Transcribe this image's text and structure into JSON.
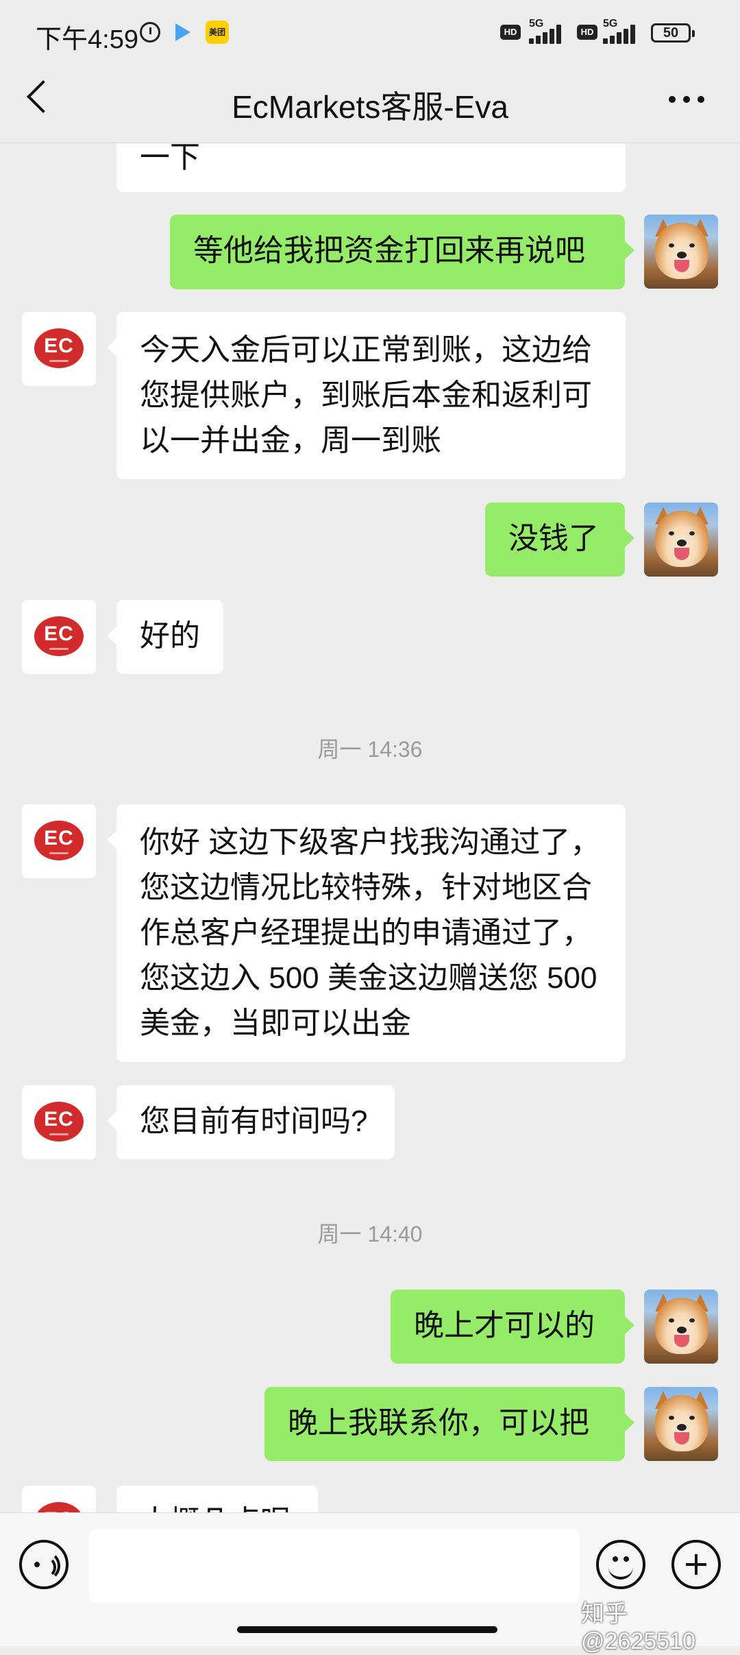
{
  "status_bar": {
    "time": "下午4:59",
    "app_badge": "美团",
    "network_1": "5G",
    "network_2": "5G",
    "hd_1": "HD",
    "hd_2": "HD",
    "battery": "50"
  },
  "header": {
    "title": "EcMarkets客服-Eva"
  },
  "messages": [
    {
      "side": "left",
      "lines": [
        "一下"
      ]
    },
    {
      "side": "right",
      "lines": [
        "等他给我把资金打回来再说吧"
      ]
    },
    {
      "side": "left",
      "avatar_logo": "EC",
      "lines": [
        "今天入金后可以正常到账，这边给",
        "您提供账户，到账后本金和返利可",
        "以一并出金，周一到账"
      ]
    },
    {
      "side": "right",
      "lines": [
        "没钱了"
      ]
    },
    {
      "side": "left",
      "avatar_logo": "EC",
      "lines": [
        "好的"
      ]
    },
    {
      "side": "left",
      "avatar_logo": "EC",
      "lines": [
        "你好 这边下级客户找我沟通过了，",
        "您这边情况比较特殊，针对地区合",
        "作总客户经理提出的申请通过了，",
        "您这边入 500 美金这边赠送您 500",
        "美金，当即可以出金"
      ]
    },
    {
      "side": "left",
      "avatar_logo": "EC",
      "lines": [
        "您目前有时间吗?"
      ]
    },
    {
      "side": "right",
      "lines": [
        "晚上才可以的"
      ]
    },
    {
      "side": "right",
      "lines": [
        "晚上我联系你，可以把"
      ]
    },
    {
      "side": "left",
      "avatar_logo": "EC",
      "lines": [
        "大概几点呢"
      ]
    }
  ],
  "timestamps": [
    "周一 14:36",
    "周一 14:40"
  ],
  "input_bar": {
    "voice_icon": "voice-icon",
    "emoji_icon": "emoji-icon",
    "plus_icon": "plus-icon",
    "watermark": "知乎 @2625510"
  }
}
